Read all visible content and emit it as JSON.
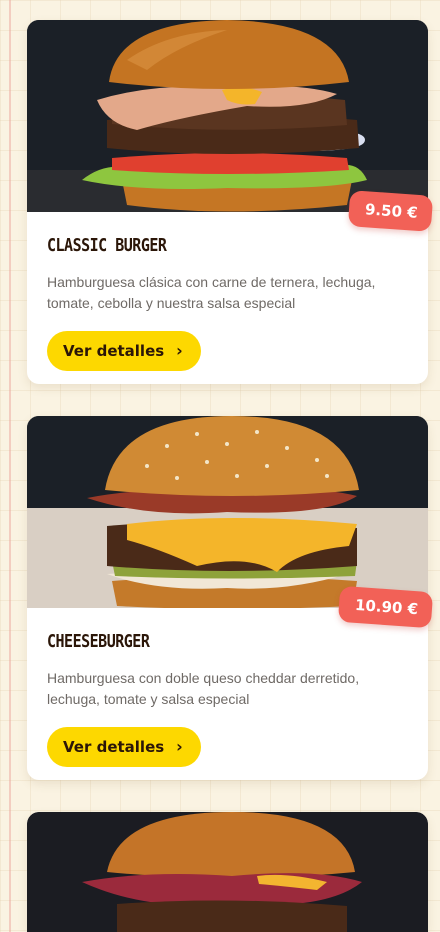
{
  "products": [
    {
      "name": "CLASSIC BURGER",
      "description": "Hamburguesa clásica con carne de ternera, lechuga, tomate, cebolla y nuestra salsa especial",
      "price": "9.50 €",
      "button_label": "Ver detalles"
    },
    {
      "name": "CHEESEBURGER",
      "description": "Hamburguesa con doble queso cheddar derretido, lechuga, tomate y salsa especial",
      "price": "10.90 €",
      "button_label": "Ver detalles"
    }
  ],
  "icons": {
    "chevron": "chevron-right-icon"
  },
  "colors": {
    "accent": "#fdd800",
    "price": "#f26157",
    "title": "#2b1608",
    "background": "#faf3e2"
  }
}
